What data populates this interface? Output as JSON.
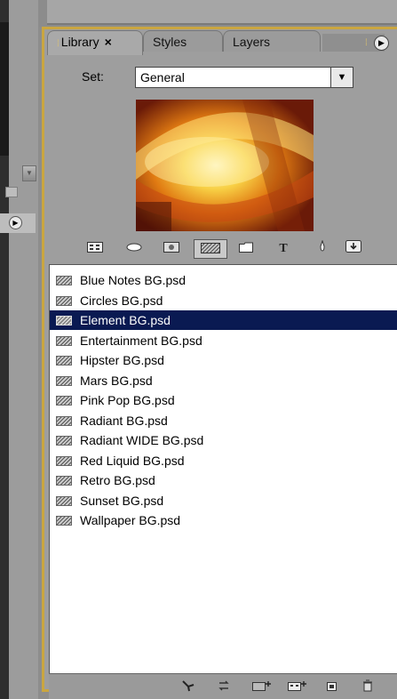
{
  "tabs": [
    {
      "label": "Library",
      "close": "×"
    },
    {
      "label": "Styles"
    },
    {
      "label": "Layers"
    }
  ],
  "set": {
    "label": "Set:",
    "value": "General"
  },
  "toolbar": {
    "icons": [
      "grid-view-icon",
      "oval-shape-icon",
      "image-icon",
      "background-icon",
      "folder-icon",
      "text-icon",
      "brush-icon",
      "download-icon"
    ],
    "text_icon_glyph": "T",
    "selected": "background-icon"
  },
  "files": [
    "Blue Notes BG.psd",
    "Circles BG.psd",
    "Element BG.psd",
    "Entertainment BG.psd",
    "Hipster BG.psd",
    "Mars BG.psd",
    "Pink Pop BG.psd",
    "Radiant BG.psd",
    "Radiant WIDE BG.psd",
    "Red Liquid BG.psd",
    "Retro BG.psd",
    "Sunset BG.psd",
    "Wallpaper BG.psd"
  ],
  "selected_file": "Element BG.psd",
  "bottom_icons": [
    "apply-arrow-icon",
    "replace-icon",
    "new-background-icon",
    "new-grid-icon",
    "new-item-icon",
    "trash-icon"
  ],
  "colors": {
    "accent": "#caa640",
    "selection": "#0a1a52"
  }
}
